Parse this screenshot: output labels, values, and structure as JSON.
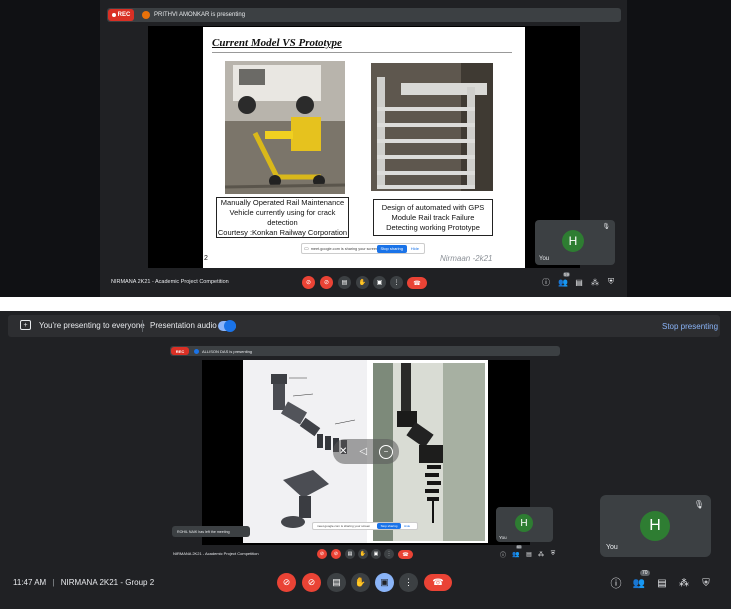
{
  "top": {
    "rec_label": "REC",
    "presenter_text": "PRITHVI AMONKAR is presenting",
    "slide": {
      "title": "Current Model VS Prototype",
      "caption_left": [
        "Manually Operated Rail Maintenance",
        "Vehicle currently using for crack",
        "detection",
        "Courtesy :Konkan Railway Corporation"
      ],
      "caption_right": [
        "Design of automated with GPS",
        "Module Rail track Failure",
        "Detecting working Prototype"
      ],
      "page_number": "2",
      "footer_brand": "Nirmaan -2k21"
    },
    "share_toast": {
      "text": "meet.google.com is sharing your screen",
      "stop": "Stop sharing",
      "hide": "Hide"
    },
    "self_tile": {
      "avatar_letter": "H",
      "label": "You"
    },
    "meeting_name": "NIRMANA 2K21 - Academic Project Competition",
    "people_count": "59"
  },
  "bottom": {
    "presenting_text": "You're presenting to everyone",
    "audio_label": "Presentation audio",
    "stop_presenting": "Stop presenting",
    "inner": {
      "rec_label": "REC",
      "presenter_text": "ALLISON DAS is presenting",
      "share_toast": {
        "text": "meet.google.com is sharing your screen",
        "stop": "Stop sharing",
        "hide": "Hide"
      },
      "notification": "ROHIL NAIK has left the meeting",
      "meeting_name": "NIRMANA 2K21 - Academic Project Competition",
      "self_tile": {
        "avatar_letter": "H",
        "label": "You"
      },
      "people_count": "60"
    },
    "self_tile": {
      "avatar_letter": "H",
      "label": "You"
    },
    "time": "11:47 AM",
    "separator": "|",
    "meeting_name": "NIRMANA 2K21 - Group 2",
    "people_count": "70"
  },
  "colors": {
    "meet_bg": "#202124",
    "red": "#ea4335",
    "blue": "#8ab4f8",
    "avatar_green": "#2e7d32"
  },
  "icons": [
    "mic-off-icon",
    "camera-off-icon",
    "captions-icon",
    "raise-hand-icon",
    "present-icon",
    "more-icon",
    "hang-up-icon",
    "info-icon",
    "people-icon",
    "chat-icon",
    "activities-icon",
    "host-controls-icon"
  ]
}
